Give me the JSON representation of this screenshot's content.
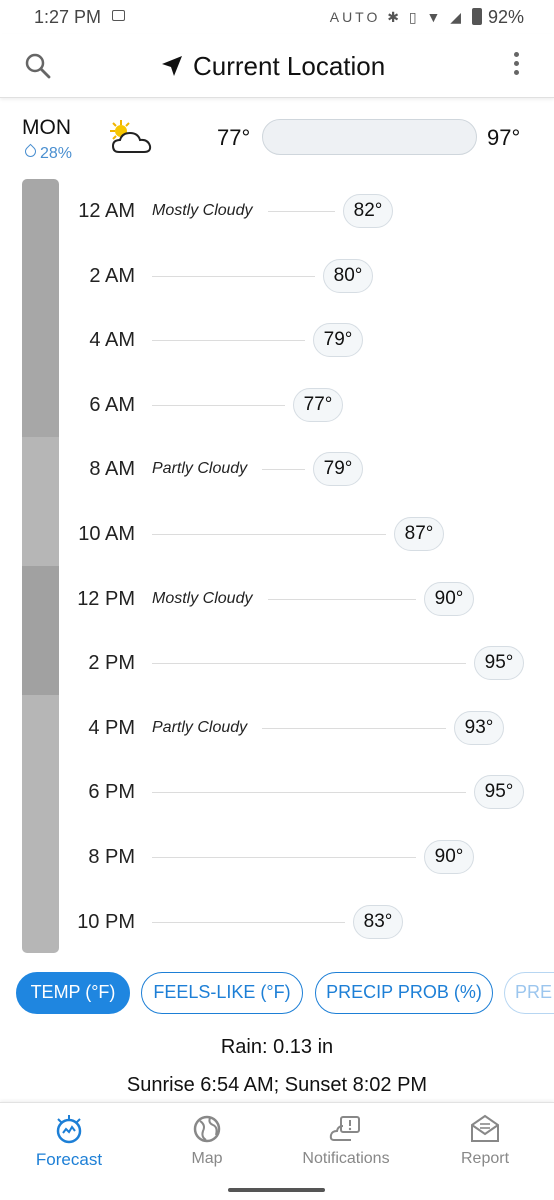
{
  "status_bar": {
    "time": "1:27 PM",
    "icons": "AUTO ✱ ▯ ▼ ◢",
    "battery": "92%"
  },
  "header": {
    "title": "Current Location"
  },
  "day_summary": {
    "day": "MON",
    "precip": "28%",
    "low": "77°",
    "high": "97°",
    "weather_icon": "partly-cloudy-icon"
  },
  "cloud_cover_segments": [
    {
      "shade": "#a7a7a7"
    },
    {
      "shade": "#b6b6b6"
    },
    {
      "shade": "#a1a1a1"
    },
    {
      "shade": "#b6b6b6"
    }
  ],
  "hourly": [
    {
      "hour": "12 AM",
      "condition": "Mostly Cloudy",
      "temp": "82°",
      "temp_value": 82
    },
    {
      "hour": "2 AM",
      "condition": "",
      "temp": "80°",
      "temp_value": 80
    },
    {
      "hour": "4 AM",
      "condition": "",
      "temp": "79°",
      "temp_value": 79
    },
    {
      "hour": "6 AM",
      "condition": "",
      "temp": "77°",
      "temp_value": 77
    },
    {
      "hour": "8 AM",
      "condition": "Partly Cloudy",
      "temp": "79°",
      "temp_value": 79
    },
    {
      "hour": "10 AM",
      "condition": "",
      "temp": "87°",
      "temp_value": 87
    },
    {
      "hour": "12 PM",
      "condition": "Mostly Cloudy",
      "temp": "90°",
      "temp_value": 90
    },
    {
      "hour": "2 PM",
      "condition": "",
      "temp": "95°",
      "temp_value": 95
    },
    {
      "hour": "4 PM",
      "condition": "Partly Cloudy",
      "temp": "93°",
      "temp_value": 93
    },
    {
      "hour": "6 PM",
      "condition": "",
      "temp": "95°",
      "temp_value": 95
    },
    {
      "hour": "8 PM",
      "condition": "",
      "temp": "90°",
      "temp_value": 90
    },
    {
      "hour": "10 PM",
      "condition": "",
      "temp": "83°",
      "temp_value": 83
    }
  ],
  "chips": [
    {
      "label": "TEMP (°F)",
      "active": true
    },
    {
      "label": "FEELS-LIKE (°F)",
      "active": false
    },
    {
      "label": "PRECIP PROB (%)",
      "active": false
    },
    {
      "label": "PRE",
      "active": false
    }
  ],
  "details": {
    "rain": "Rain: 0.13 in",
    "sun": "Sunrise 6:54 AM; Sunset 8:02 PM"
  },
  "bottom_nav": [
    {
      "label": "Forecast",
      "icon": "forecast-icon",
      "active": true
    },
    {
      "label": "Map",
      "icon": "globe-icon",
      "active": false
    },
    {
      "label": "Notifications",
      "icon": "notifications-icon",
      "active": false
    },
    {
      "label": "Report",
      "icon": "report-icon",
      "active": false
    }
  ],
  "colors": {
    "accent": "#1f86e0",
    "precip": "#4a8fd0"
  }
}
